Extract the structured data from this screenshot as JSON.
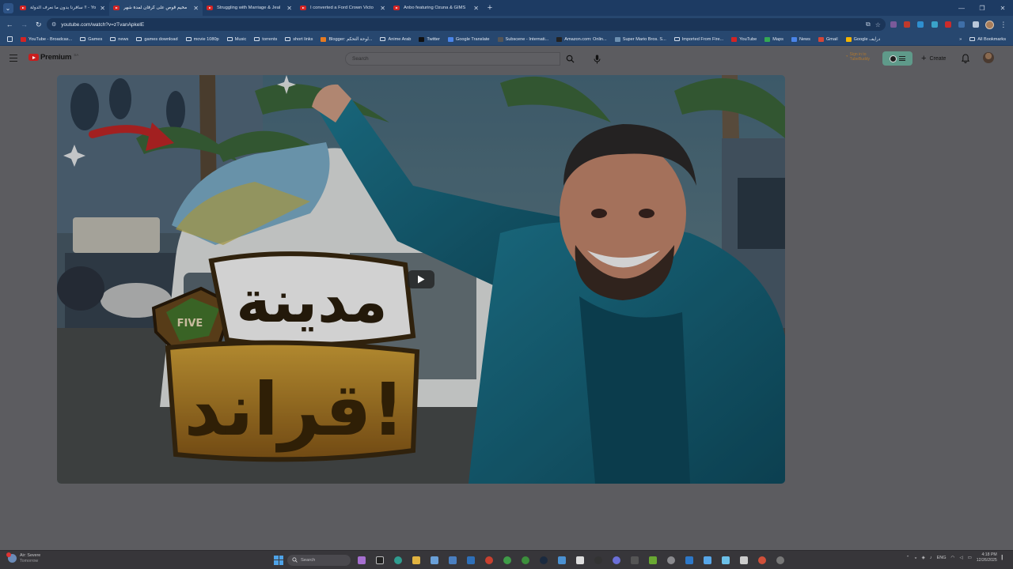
{
  "browser": {
    "tabs": [
      {
        "title": "سافرنا بدون ما نعرف الدولة !! - Yo",
        "active": false
      },
      {
        "title": "مخيم قوص على كرفان لمدة شهر",
        "active": true
      },
      {
        "title": "Struggling with Marriage & Jeal",
        "active": false
      },
      {
        "title": "I converted a Ford Crown Victo",
        "active": false
      },
      {
        "title": "Anbo featuring Ozuna & GIMS",
        "active": false
      }
    ],
    "new_tab": "+",
    "url": "youtube.com/watch?v=zTvanApkelE",
    "bookmarks": [
      {
        "label": "YouTube - Broadcas...",
        "icon": "youtube-icon",
        "color": "#d32424"
      },
      {
        "label": "Games",
        "icon": "folder-icon"
      },
      {
        "label": "news",
        "icon": "folder-icon"
      },
      {
        "label": "games download",
        "icon": "folder-icon"
      },
      {
        "label": "movie 1080p",
        "icon": "folder-icon"
      },
      {
        "label": "Music",
        "icon": "folder-icon"
      },
      {
        "label": "torrents",
        "icon": "folder-icon"
      },
      {
        "label": "short links",
        "icon": "folder-icon"
      },
      {
        "label": "Blogger: لوحة التحكم...",
        "icon": "blogger-icon",
        "color": "#e57a21"
      },
      {
        "label": "Anime Arab",
        "icon": "folder-icon"
      },
      {
        "label": "Twitter",
        "icon": "x-icon",
        "color": "#111111"
      },
      {
        "label": "Google Translate",
        "icon": "translate-icon",
        "color": "#4a84e8"
      },
      {
        "label": "Subscene - Internati...",
        "icon": "subscene-icon",
        "color": "#555555"
      },
      {
        "label": "Amazon.com: Onlin...",
        "icon": "amazon-icon",
        "color": "#222222"
      },
      {
        "label": "Super Mario Bros. S...",
        "icon": "page-icon",
        "color": "#6c8fb0"
      },
      {
        "label": "Imported From Fire...",
        "icon": "folder-icon"
      },
      {
        "label": "YouTube",
        "icon": "youtube-icon",
        "color": "#d32424"
      },
      {
        "label": "Maps",
        "icon": "maps-icon",
        "color": "#34a853"
      },
      {
        "label": "News",
        "icon": "news-icon",
        "color": "#4a84e8"
      },
      {
        "label": "Gmail",
        "icon": "gmail-icon",
        "color": "#d44638"
      },
      {
        "label": "Google درايف",
        "icon": "drive-icon",
        "color": "#f4b400"
      }
    ],
    "more_bookmarks": "»",
    "all_bookmarks": "All Bookmarks"
  },
  "youtube": {
    "logo": "Premium",
    "logo_region": "SA",
    "search_placeholder": "Search",
    "tubebuddy_line1": "Sign in to",
    "tubebuddy_line2": "TubeBuddy",
    "create_label": "Create"
  },
  "video": {
    "thumbnail_text_line1": "مدينة",
    "thumbnail_text_line2": "قراند!",
    "badge_text": "FIVE"
  },
  "taskbar": {
    "weather_title": "Air: Severe",
    "weather_sub": "Tomorrow",
    "weather_badge": "3",
    "search_label": "Search",
    "language": "ENG",
    "time": "4:18 PM",
    "date": "12/26/2025"
  }
}
